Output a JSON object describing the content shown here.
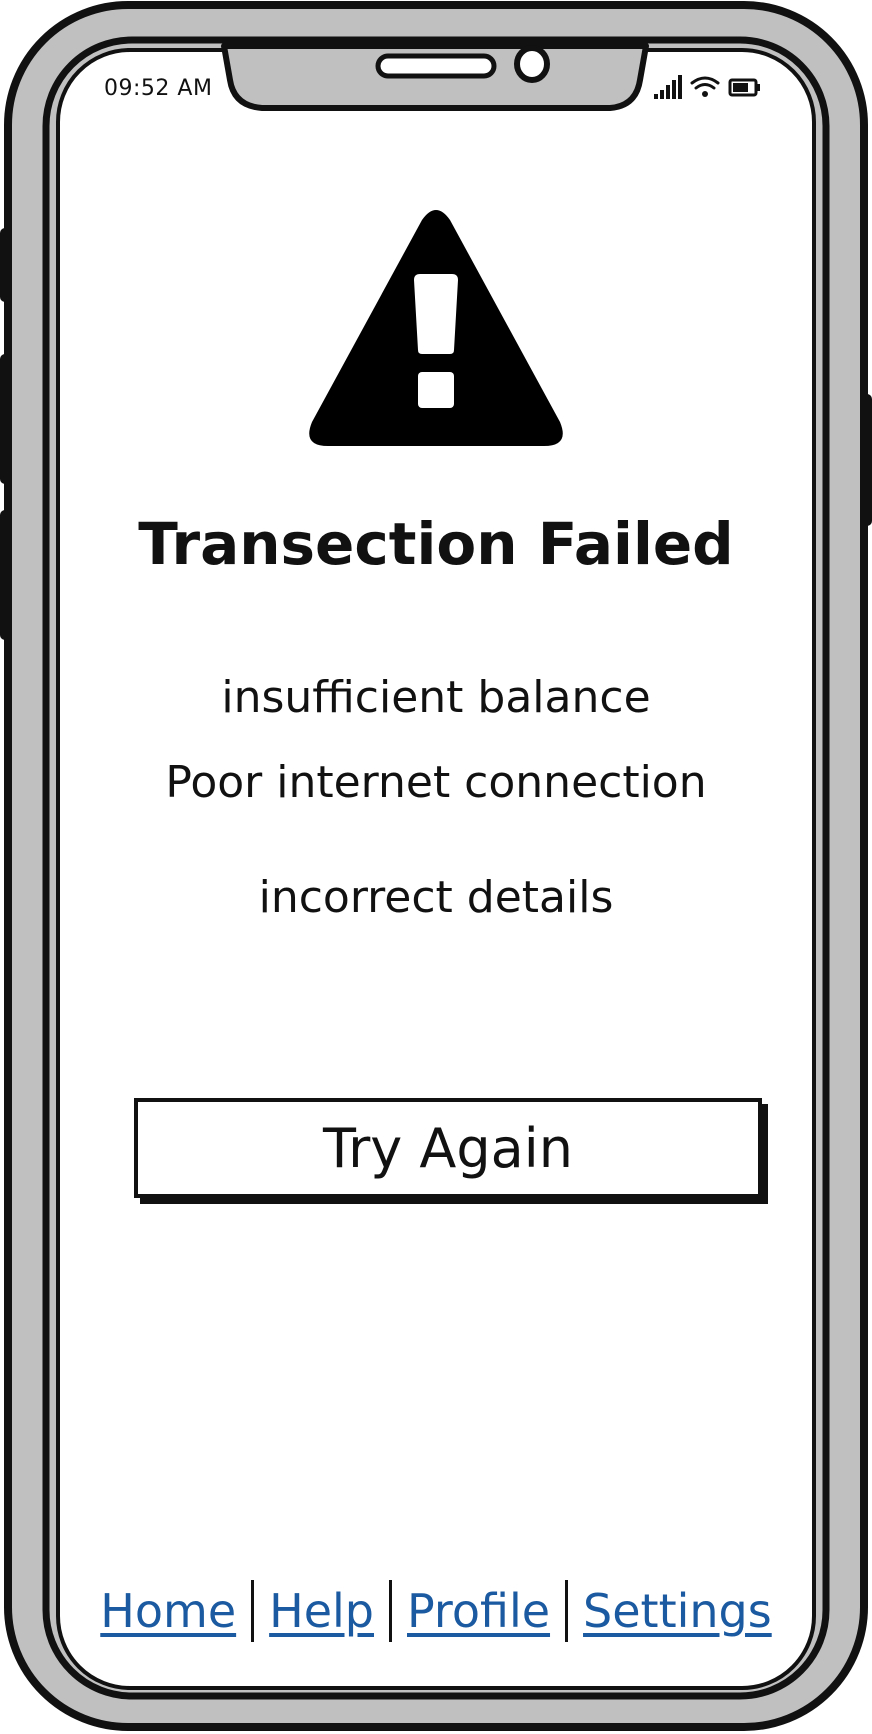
{
  "status_bar": {
    "time": "09:52 AM",
    "icons": [
      "signal-icon",
      "wifi-icon",
      "battery-icon"
    ]
  },
  "alert": {
    "icon": "warning-icon",
    "title": "Transection Failed",
    "reasons": [
      "insufficient balance",
      "Poor internet connection",
      "incorrect details"
    ]
  },
  "actions": {
    "retry_label": "Try Again"
  },
  "bottom_nav": {
    "items": [
      {
        "label": "Home"
      },
      {
        "label": "Help"
      },
      {
        "label": "Profile"
      },
      {
        "label": "Settings"
      }
    ]
  },
  "colors": {
    "frame": "#c0c0c0",
    "outline": "#111111",
    "link": "#1b5aa0"
  }
}
